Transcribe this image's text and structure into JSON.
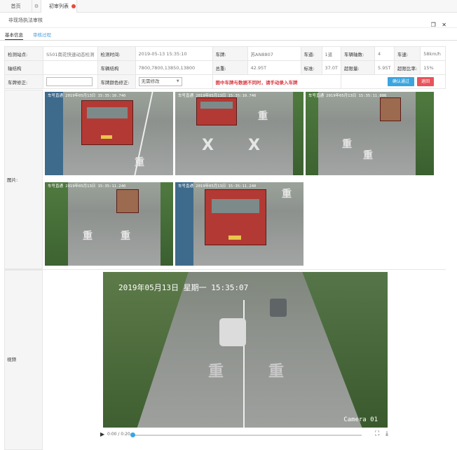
{
  "tabs": {
    "home": "首页",
    "active": "初审列表"
  },
  "panel": {
    "title": "非现场执法审核",
    "win_icons": "❐ ✕"
  },
  "subtabs": {
    "basic": "基本信息",
    "process": "审核过程"
  },
  "info": {
    "station_label": "检测站点:",
    "station_value": "S501南花快速动态检测",
    "time_label": "检测时间:",
    "time_value": "2019-05-13 15:35:10",
    "plate_label": "车牌:",
    "plate_value": "苏AN8807",
    "lane_label": "车道:",
    "lane_value": "1道",
    "axles_label": "车辆轴数:",
    "axles_value": "4",
    "speed_label": "车速:",
    "speed_value": "58km/h",
    "axle_struct_label": "轴结构",
    "axle_struct_value": "",
    "vehicle_struct_label": "车辆结构",
    "vehicle_struct_value": "7800,7800,13850,13800",
    "total_label": "总重:",
    "total_value": "42.95T",
    "limit_label": "标准:",
    "limit_value": "37.0T",
    "over_label": "超限量:",
    "over_value": "5.95T",
    "rate_label": "超限比率:",
    "rate_value": "15%",
    "plate_fix_label": "车牌修正:",
    "plate_fix_value": "",
    "color_fix_label": "车牌颜色修正:",
    "color_fix_value": "无需修改",
    "warning": "图中车牌与数据不同时，请手动录入车牌",
    "confirm_btn": "确认通过",
    "reject_btn": "退回"
  },
  "images_label": "图片:",
  "images": [
    {
      "stamp": "车号直通 2019年05月13日 15:35:10.740"
    },
    {
      "stamp": "车号直通 2019年05月13日 15:35:10.740"
    },
    {
      "stamp": "车号直通 2019年05月13日 15:35:11.000"
    },
    {
      "stamp": "车号直通 2019年05月13日 15:35:11.240"
    },
    {
      "stamp": "车号直通 2019年05月13日 15:35:11.240"
    }
  ],
  "road_text": {
    "a": "重",
    "b": "X"
  },
  "video_label": "视频",
  "video": {
    "stamp": "2019年05月13日  星期一  15:35:07",
    "camera": "Camera 01",
    "time": "0:00 / 0:20",
    "progress": 0
  }
}
